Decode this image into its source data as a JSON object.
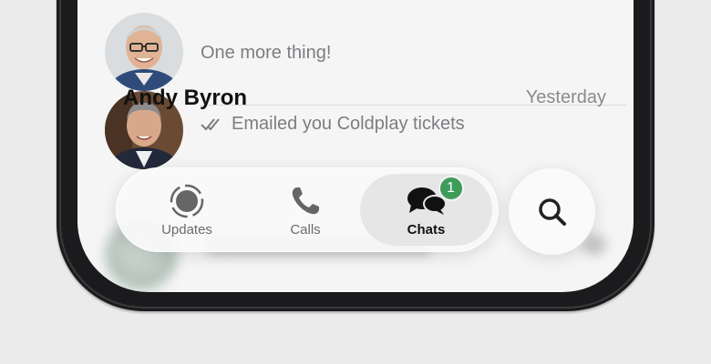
{
  "chats": [
    {
      "name": "",
      "time": "",
      "preview": "One more thing!",
      "avatar": "person-photo-avatar"
    },
    {
      "name": "Andy Byron",
      "time": "Yesterday",
      "preview": "Emailed you Coldplay tickets",
      "read_receipt": "double-check-icon",
      "avatar": "person-photo-avatar"
    }
  ],
  "tabs": [
    {
      "label": "Updates",
      "icon": "updates-icon",
      "active": false
    },
    {
      "label": "Calls",
      "icon": "phone-icon",
      "active": false
    },
    {
      "label": "Chats",
      "icon": "chat-bubbles-icon",
      "active": true,
      "badge": "1"
    }
  ],
  "search": {
    "icon": "search-icon"
  },
  "colors": {
    "background": "#ebebeb",
    "screen": "#f5f5f5",
    "badge": "#3e9c5b",
    "name_text": "#111111",
    "secondary_text": "#7d7d82"
  }
}
